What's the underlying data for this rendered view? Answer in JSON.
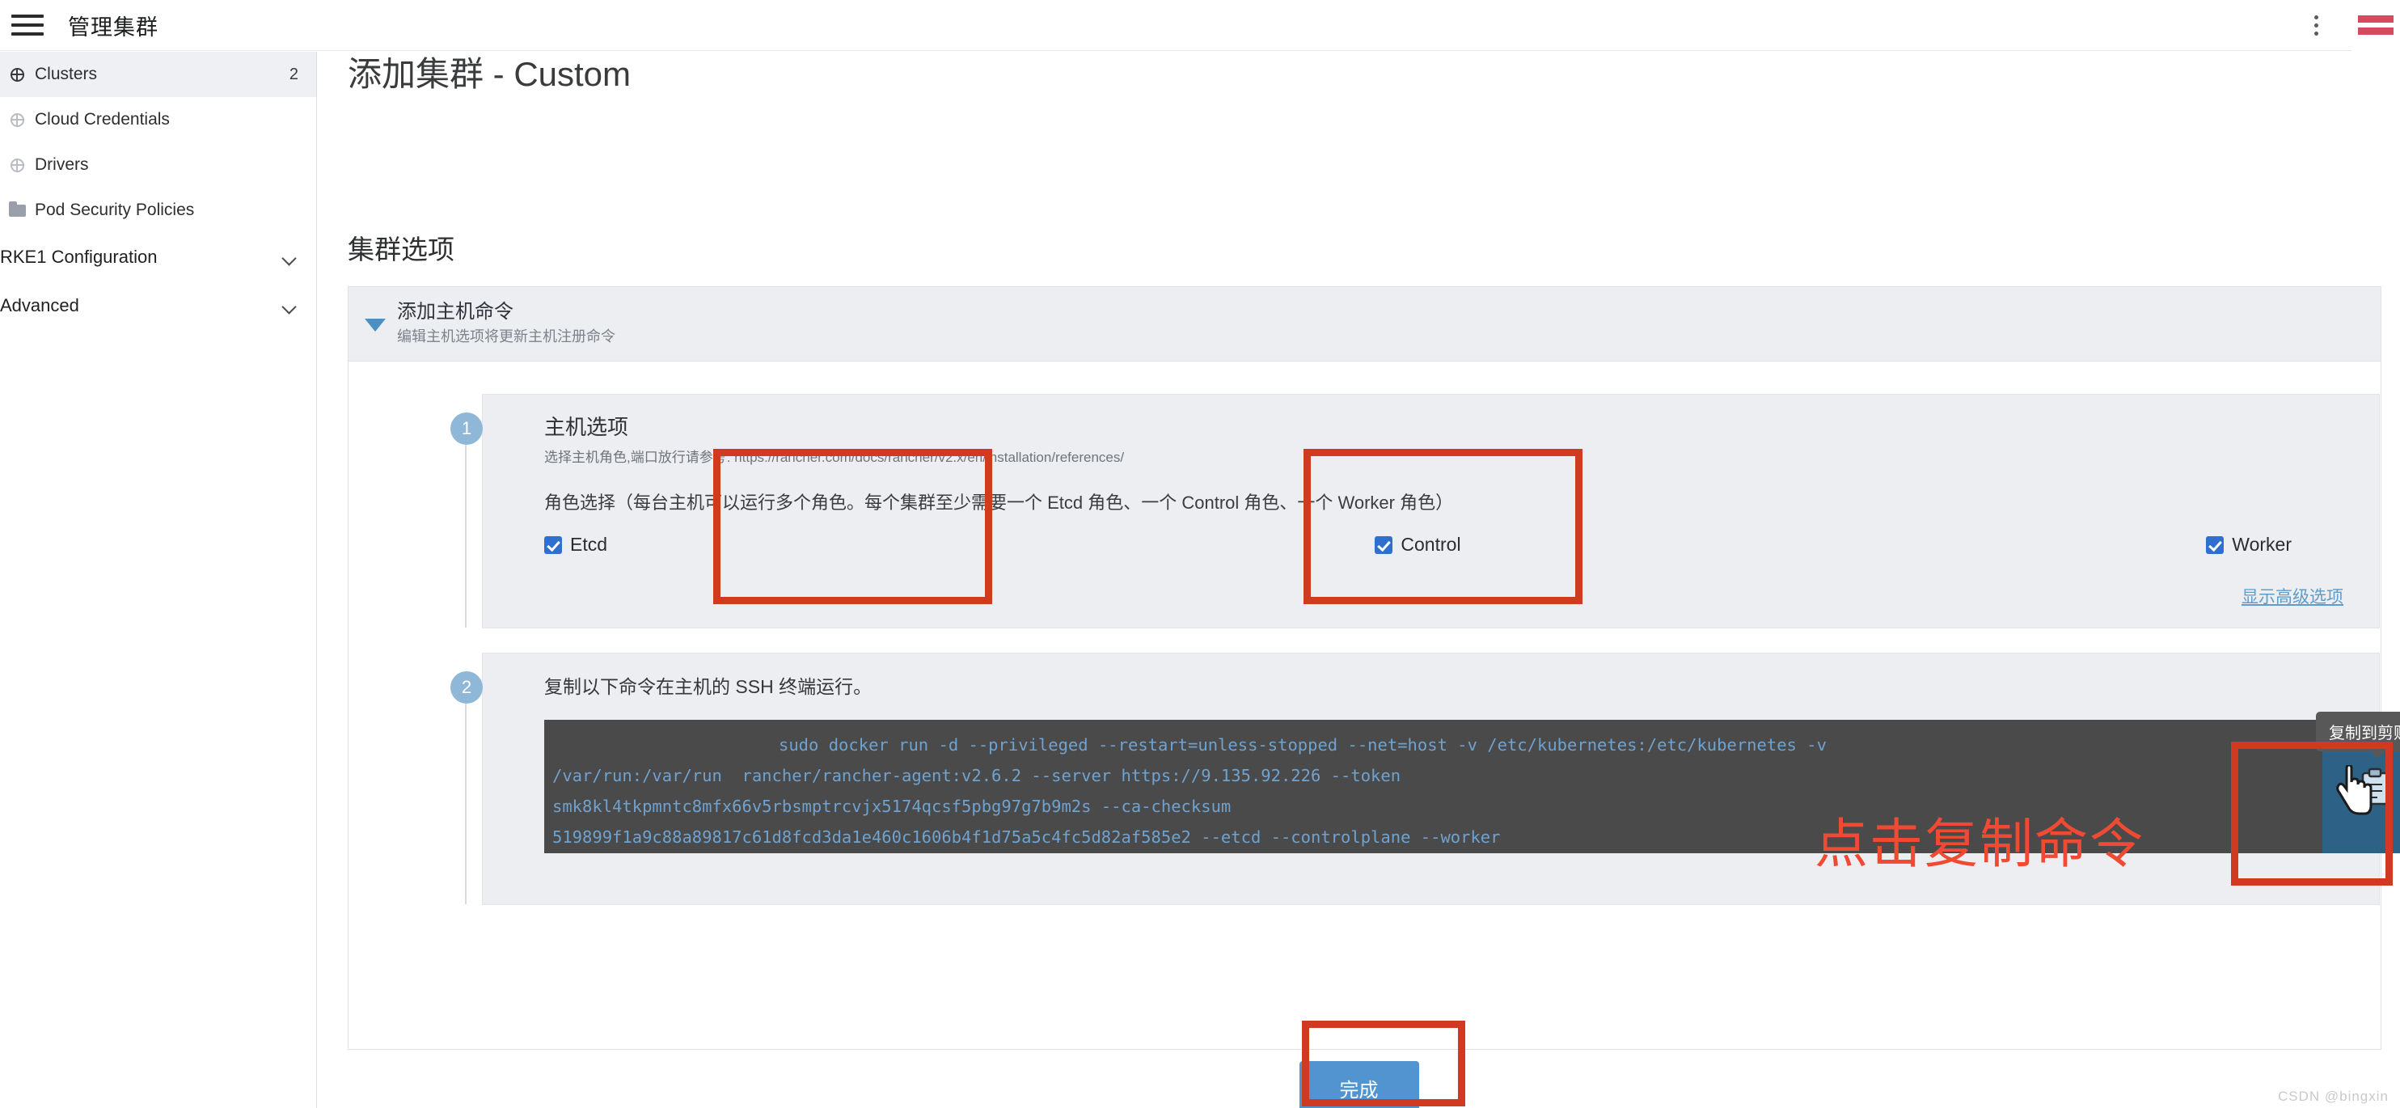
{
  "topbar": {
    "menu_icon": "hamburger-icon",
    "title": "管理集群",
    "more_icon": "kebab-menu-icon"
  },
  "sidebar": {
    "items": [
      {
        "label": "Clusters",
        "icon": "globe-icon",
        "count": "2",
        "selected": true
      },
      {
        "label": "Cloud Credentials",
        "icon": "globe-icon",
        "count": "",
        "selected": false
      },
      {
        "label": "Drivers",
        "icon": "globe-icon",
        "count": "",
        "selected": false
      },
      {
        "label": "Pod Security Policies",
        "icon": "folder-icon",
        "count": "",
        "selected": false
      }
    ],
    "groups": [
      {
        "label": "RKE1 Configuration",
        "icon": "chevron-down-icon"
      },
      {
        "label": "Advanced",
        "icon": "chevron-down-icon"
      }
    ]
  },
  "main": {
    "page_title": "添加集群 - Custom",
    "section_title": "集群选项",
    "panel": {
      "caret_icon": "caret-down-icon",
      "title": "添加主机命令",
      "subtitle": "编辑主机选项将更新主机注册命令"
    },
    "step1": {
      "badge": "1",
      "heading": "主机选项",
      "subtitle": "选择主机角色,端口放行请参考: https://rancher.com/docs/rancher/v2.x/en/installation/references/",
      "roles_line": "角色选择（每台主机可以运行多个角色。每个集群至少需要一个 Etcd 角色、一个 Control 角色、一个 Worker 角色）",
      "checkboxes": [
        {
          "label": "Etcd",
          "checked": true
        },
        {
          "label": "Control",
          "checked": true
        },
        {
          "label": "Worker",
          "checked": true
        }
      ],
      "advanced_link": "显示高级选项"
    },
    "step2": {
      "badge": "2",
      "instruction": "复制以下命令在主机的 SSH 终端运行。",
      "command_lines": [
        "sudo docker run -d --privileged --restart=unless-stopped --net=host -v /etc/kubernetes:/etc/kubernetes -v",
        "/var/run:/var/run  rancher/rancher-agent:v2.6.2 --server https://9.135.92.226 --token",
        "smk8kl4tkpmntc8mfx66v5rbsmptrcvjx5174qcsf5pbg97g7b9m2s --ca-checksum",
        "519899f1a9c88a89817c61d8fcd3da1e460c1606b4f1d75a5c4fc5d82af585e2 --etcd --controlplane --worker"
      ],
      "copy_tooltip": "复制到剪贴板",
      "copy_icon": "clipboard-copy-icon"
    },
    "finish_button": "完成"
  },
  "annotations": {
    "callout_text": "点击复制命令",
    "callout_color": "#ef4a33",
    "box_color": "#cf3a20"
  },
  "watermark": "CSDN @bingxin",
  "colors": {
    "accent_blue": "#5294cf",
    "checkbox_blue": "#2f6fd0",
    "copy_button_blue": "#2e6186",
    "code_bg": "#4a4a4a",
    "code_text": "#6fa2cf",
    "panel_bg": "#eceef1",
    "brand_red": "#d64a5f"
  }
}
